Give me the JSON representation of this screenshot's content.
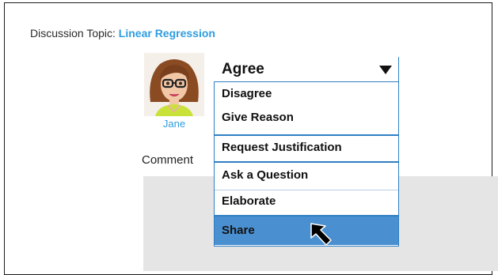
{
  "topic": {
    "label": "Discussion Topic:",
    "value": "Linear Regression"
  },
  "user": {
    "name": "Jane"
  },
  "comment": {
    "label": "Comment"
  },
  "dropdown": {
    "selected": "Agree",
    "options": [
      "Disagree",
      "Give Reason",
      "Request Justification",
      "Ask a Question",
      "Elaborate",
      "Share"
    ],
    "highlighted": "Share"
  },
  "colors": {
    "link": "#2f9de0",
    "menu_border": "#2e7fc4",
    "highlight": "#4a8fd0",
    "comment_bg": "#e5e5e5"
  },
  "icons": {
    "cursor": "arrow-pointer-icon",
    "dropdown": "caret-down-icon"
  }
}
